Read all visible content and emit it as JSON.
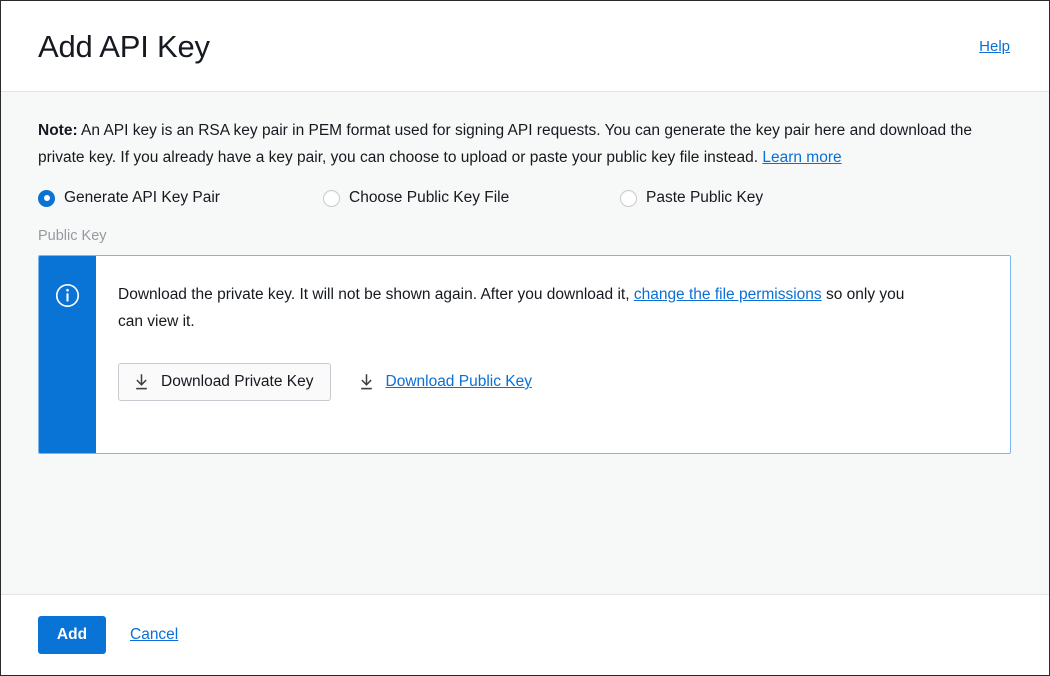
{
  "header": {
    "title": "Add API Key",
    "help_label": "Help"
  },
  "note": {
    "prefix": "Note:",
    "text_before_link": " An API key is an RSA key pair in PEM format used for signing API requests. You can generate the key pair here and download the private key. If you already have a key pair, you can choose to upload or paste your public key file instead. ",
    "link_label": "Learn more"
  },
  "key_source": {
    "selected": "Generate API Key Pair",
    "options": [
      {
        "label": "Generate API Key Pair",
        "checked": true
      },
      {
        "label": "Choose Public Key File",
        "checked": false
      },
      {
        "label": "Paste Public Key",
        "checked": false
      }
    ]
  },
  "field": {
    "public_key_label": "Public Key"
  },
  "alert": {
    "icon": "info-circle-icon",
    "text_part1": "Download the private key. It will not be shown again. After you download it, ",
    "link1": "change the file permissions",
    "text_part2": " so only you can view it.",
    "download_private_key_label": "Download Private Key",
    "download_public_key_label": "Download Public Key",
    "download_icon": "download-icon"
  },
  "footer": {
    "add_label": "Add",
    "cancel_label": "Cancel"
  },
  "colors": {
    "accent_blue": "#0a74d6",
    "link_blue": "#0a6fd6",
    "alert_border": "#7cb6ea",
    "body_background": "#f7f8f8",
    "text": "#16191f",
    "muted_label": "#959aa0"
  }
}
